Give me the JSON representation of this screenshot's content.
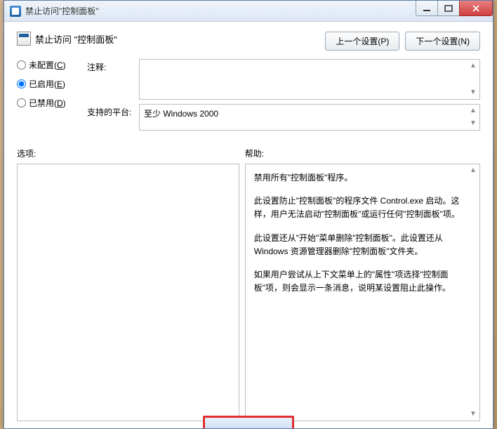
{
  "window": {
    "title": "禁止访问\"控制面板\""
  },
  "header": {
    "title": "禁止访问 \"控制面板\""
  },
  "nav": {
    "prev": "上一个设置(P)",
    "next": "下一个设置(N)"
  },
  "radios": {
    "not_configured": {
      "label": "未配置(",
      "key": "C",
      "suffix": ")",
      "checked": false
    },
    "enabled": {
      "label": "已启用(",
      "key": "E",
      "suffix": ")",
      "checked": true
    },
    "disabled": {
      "label": "已禁用(",
      "key": "D",
      "suffix": ")",
      "checked": false
    }
  },
  "fields": {
    "comment_label": "注释:",
    "comment_value": "",
    "platform_label": "支持的平台:",
    "platform_value": "至少 Windows 2000"
  },
  "panels": {
    "options_label": "选项:",
    "help_label": "帮助:"
  },
  "help": {
    "p1": "禁用所有\"控制面板\"程序。",
    "p2": "此设置防止\"控制面板\"的程序文件 Control.exe 启动。这样，用户无法启动\"控制面板\"或运行任何\"控制面板\"项。",
    "p3": "此设置还从\"开始\"菜单删除\"控制面板\"。此设置还从 Windows 资源管理器删除\"控制面板\"文件夹。",
    "p4": "如果用户尝试从上下文菜单上的\"属性\"项选择\"控制面板\"项，则会显示一条消息，说明某设置阻止此操作。"
  }
}
